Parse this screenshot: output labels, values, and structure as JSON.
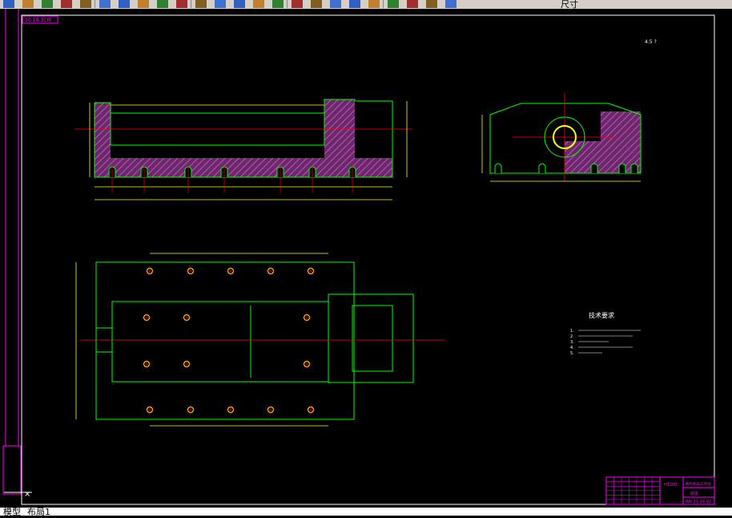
{
  "toolbar": {
    "buttons": [
      "open-icon",
      "save-icon",
      "print-icon",
      "plot-preview-icon",
      "publish-icon",
      "cut-icon",
      "copy-icon",
      "paste-icon",
      "match-properties-icon",
      "undo-icon",
      "redo-icon",
      "pan-icon",
      "zoom-realtime-icon",
      "zoom-window-icon",
      "zoom-previous-icon",
      "properties-icon",
      "design-center-icon",
      "tool-palettes-icon",
      "sheet-set-icon",
      "markup-icon",
      "quickcalc-icon",
      "help-icon",
      "layer-manager-icon",
      "layer-state-icon"
    ],
    "text_label": "尺寸"
  },
  "colors": {
    "background": "#000000",
    "outline": "#00ff00",
    "centerline": "#ff0000",
    "dimension": "#ffff00",
    "hatch": "#b040b0",
    "frame": "#ff00ff",
    "border": "#ffffff",
    "circle": "#ffff00"
  },
  "drawing": {
    "frame_tag": "30-18-3CM",
    "scale_note": "4:5 ?",
    "tech_requirements_title": "技术要求",
    "tech_requirements": [
      "1.",
      "2.",
      "3.",
      "4.",
      "5."
    ],
    "title_block": {
      "material": "HT200",
      "part_name": "数控机床工作台",
      "drawing_label": "底座",
      "drawing_number": "WK-33-18-02"
    }
  },
  "tabs": {
    "model": "模型",
    "layout": "布局1"
  }
}
